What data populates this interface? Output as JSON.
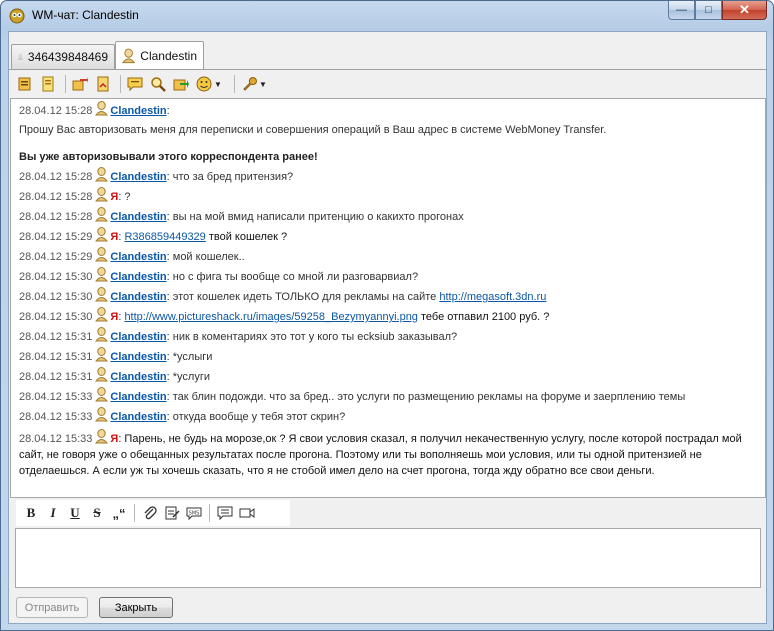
{
  "window": {
    "title": "WM-чат: Clandestin",
    "minimize_label": "—",
    "maximize_label": "□",
    "close_label": "✕"
  },
  "tabs": [
    {
      "label": "346439848469",
      "active": false
    },
    {
      "label": "Clandestin",
      "active": true
    }
  ],
  "toolbar": {
    "icons": [
      "contacts-icon",
      "info-icon",
      "send-money-icon",
      "invoice-icon",
      "message-icon",
      "search-icon",
      "export-icon",
      "emoticon-icon",
      "settings-icon"
    ]
  },
  "messages": [
    {
      "time": "28.04.12 15:28",
      "author": "Clandestin",
      "text": ":",
      "body": "Прошу Вас авторизовать меня для переписки и совершения операций в Ваш адрес в системе WebMoney Transfer.",
      "extra": "Вы уже авторизовывали этого корреспондента ранее!"
    },
    {
      "time": "28.04.12 15:28",
      "author": "Clandestin",
      "text": ": что за бред притензия?"
    },
    {
      "time": "28.04.12 15:28",
      "author": "Я",
      "text": ": ?"
    },
    {
      "time": "28.04.12 15:28",
      "author": "Clandestin",
      "text": ": вы на мой вмид написали притенцию о какихто прогонах"
    },
    {
      "time": "28.04.12 15:29",
      "author": "Я",
      "text": ": ",
      "link": "R386859449329",
      "after": " твой кошелек ?"
    },
    {
      "time": "28.04.12 15:29",
      "author": "Clandestin",
      "text": ": мой кошелек.."
    },
    {
      "time": "28.04.12 15:30",
      "author": "Clandestin",
      "text": ": но с фига ты вообще со мной ли разговарвиал?"
    },
    {
      "time": "28.04.12 15:30",
      "author": "Clandestin",
      "text": ": этот кошелек идеть ТОЛЬКО для рекламы на сайте ",
      "link": "http://megasoft.3dn.ru"
    },
    {
      "time": "28.04.12 15:30",
      "author": "Я",
      "text": ": ",
      "link": "http://www.pictureshack.ru/images/59258_Bezymyannyi.png",
      "after": " тебе отпавил 2100 руб. ?"
    },
    {
      "time": "28.04.12 15:31",
      "author": "Clandestin",
      "text": ": ник в коментариях это тот у кого ты ecksiub заказывал?"
    },
    {
      "time": "28.04.12 15:31",
      "author": "Clandestin",
      "text": ": *услыги"
    },
    {
      "time": "28.04.12 15:31",
      "author": "Clandestin",
      "text": ": *услуги"
    },
    {
      "time": "28.04.12 15:33",
      "author": "Clandestin",
      "text": ": так блин подожди. что за бред.. это услуги по размещению рекламы на форуме и заерплению темы"
    },
    {
      "time": "28.04.12 15:33",
      "author": "Clandestin",
      "text": ": откуда вообще у тебя этот скрин?"
    },
    {
      "time": "28.04.12 15:33",
      "author": "Я",
      "text": ": Парень, не будь на морозе,ок ? Я свои условия сказал, я получил некачественную услугу, после которой пострадал мой сайт, не говоря уже о обещанных результатах после прогона. Поэтому или ты вополняешь мои условия, или ты одной притензией не отделаешься. А если уж ты хочешь сказать, что я не стобой имел дело на счет прогона, тогда жду обратно все свои деньги."
    }
  ],
  "format": {
    "bold": "B",
    "italic": "I",
    "underline": "U",
    "strike": "S",
    "quote": "„“"
  },
  "buttons": {
    "send": "Отправить",
    "close": "Закрыть"
  }
}
